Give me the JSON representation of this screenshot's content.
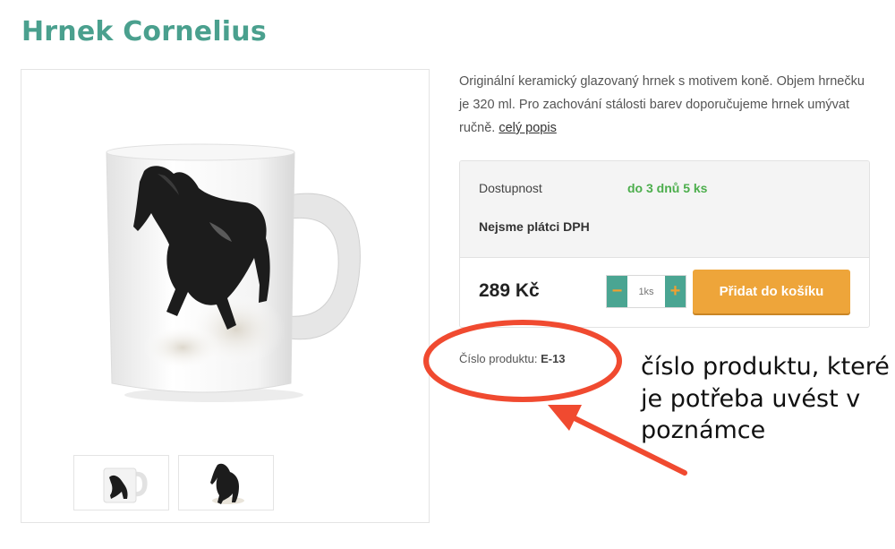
{
  "product": {
    "title": "Hrnek Cornelius",
    "description": "Originální keramický glazovaný hrnek s motivem koně. Objem hrnečku je 320 ml. Pro zachování stálosti barev doporučujeme hrnek umývat ručně.",
    "full_desc_link": "celý popis",
    "availability_label": "Dostupnost",
    "availability_value": "do 3 dnů 5 ks",
    "vat_note": "Nejsme plátci DPH",
    "price": "289 Kč",
    "quantity_placeholder": "1ks",
    "quantity_unit": "ks",
    "minus_icon": "minus-icon",
    "plus_icon": "plus-icon",
    "add_to_cart": "Přidat do košíku",
    "product_code_label": "Číslo produktu:",
    "product_code_value": "E-13"
  },
  "gallery": {
    "images": [
      "mug with black horse, front view",
      "black horse illustration"
    ]
  },
  "annotation": {
    "text": "číslo produktu, které je potřeba uvést v poznámce",
    "color": "#f04a30"
  },
  "colors": {
    "accent": "#4aa08e",
    "button": "#eea53a",
    "availability": "#4cae4c"
  }
}
